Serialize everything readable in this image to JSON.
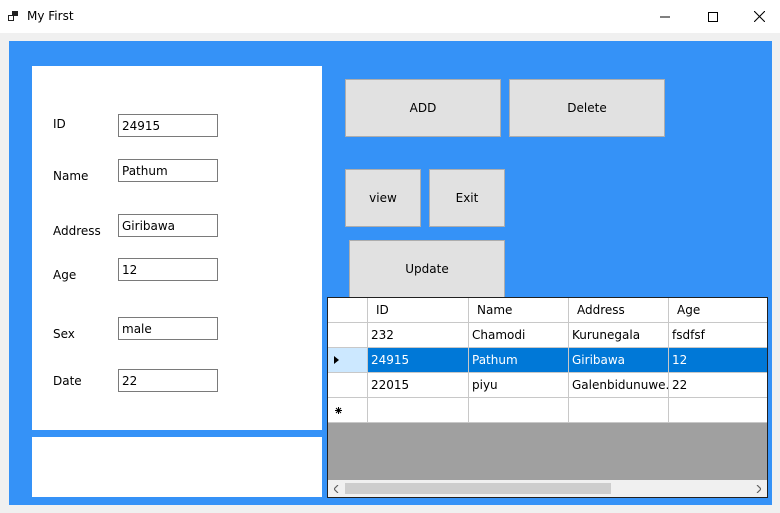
{
  "window": {
    "title": "My First"
  },
  "form": {
    "fields": [
      {
        "label": "ID",
        "value": "24915"
      },
      {
        "label": "Name",
        "value": "Pathum"
      },
      {
        "label": "Address",
        "value": "Giribawa"
      },
      {
        "label": "Age",
        "value": "12"
      },
      {
        "label": "Sex",
        "value": "male"
      },
      {
        "label": "Date",
        "value": "22"
      }
    ]
  },
  "buttons": {
    "add": "ADD",
    "delete": "Delete",
    "view": "view",
    "exit": "Exit",
    "update": "Update"
  },
  "grid": {
    "columns": [
      "ID",
      "Name",
      "Address",
      "Age"
    ],
    "rows": [
      [
        "232",
        "Chamodi",
        "Kurunegala",
        "fsdfsf"
      ],
      [
        "24915",
        "Pathum",
        "Giribawa",
        "12"
      ],
      [
        "22015",
        "piyu",
        "Galenbidunuwe...",
        "22"
      ]
    ],
    "selected_row_index": 1
  },
  "colors": {
    "client_background": "#3592f7",
    "selection": "#0078d7"
  },
  "icons": [
    "app-icon",
    "minimize-icon",
    "maximize-icon",
    "close-icon",
    "row-indicator-arrow-icon",
    "new-row-icon",
    "scroll-left-icon",
    "scroll-right-icon"
  ]
}
